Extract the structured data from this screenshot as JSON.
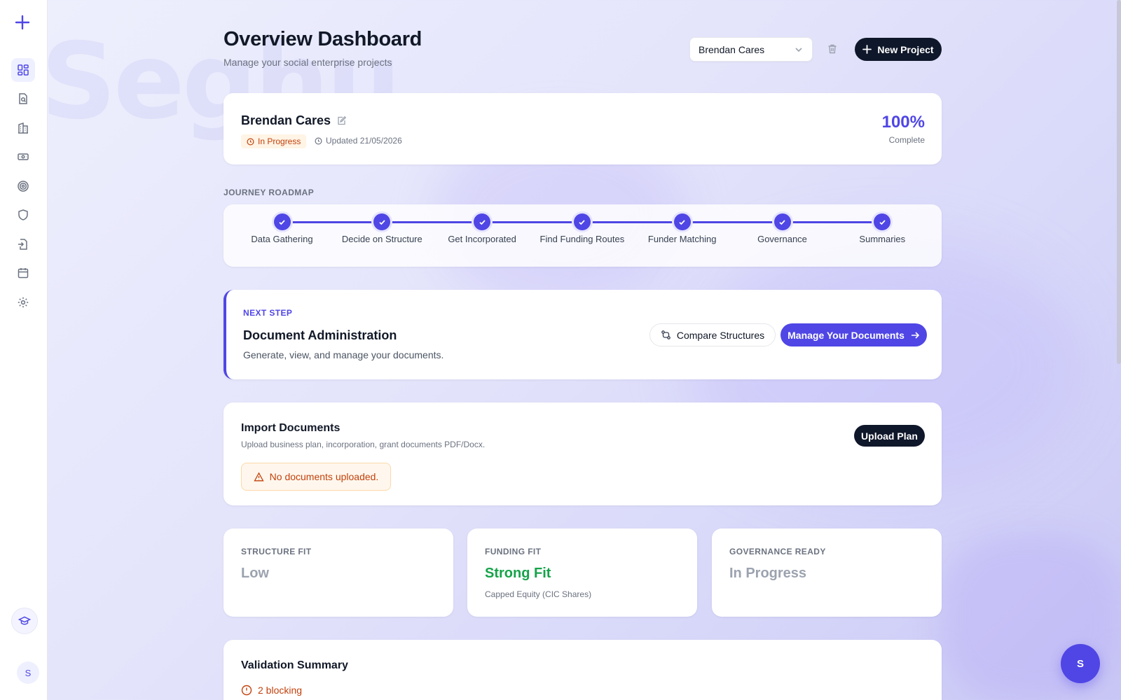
{
  "watermark": "Seghu",
  "header": {
    "title": "Overview Dashboard",
    "subtitle": "Manage your social enterprise projects",
    "project_select_value": "Brendan Cares",
    "new_project_label": "New Project"
  },
  "sidebar": {
    "items": [
      {
        "icon": "dashboard-icon",
        "active": true
      },
      {
        "icon": "document-search-icon",
        "active": false
      },
      {
        "icon": "building-icon",
        "active": false
      },
      {
        "icon": "money-icon",
        "active": false
      },
      {
        "icon": "target-icon",
        "active": false
      },
      {
        "icon": "shield-icon",
        "active": false
      },
      {
        "icon": "file-import-icon",
        "active": false
      },
      {
        "icon": "calendar-icon",
        "active": false
      },
      {
        "icon": "gear-icon",
        "active": false
      }
    ],
    "avatar_initial": "S"
  },
  "project": {
    "name": "Brendan Cares",
    "status": "In Progress",
    "updated": "Updated 21/05/2026",
    "progress_percent": "100%",
    "progress_label": "Complete",
    "progress_value": 100
  },
  "roadmap": {
    "heading": "JOURNEY ROADMAP",
    "steps": [
      {
        "label": "Data Gathering",
        "done": true
      },
      {
        "label": "Decide on Structure",
        "done": true
      },
      {
        "label": "Get Incorporated",
        "done": true
      },
      {
        "label": "Find Funding Routes",
        "done": true
      },
      {
        "label": "Funder Matching",
        "done": true
      },
      {
        "label": "Governance",
        "done": true
      },
      {
        "label": "Summaries",
        "done": true
      }
    ]
  },
  "next_step": {
    "kicker": "NEXT STEP",
    "title": "Document Administration",
    "description": "Generate, view, and manage your documents.",
    "compare_label": "Compare Structures",
    "manage_label": "Manage Your Documents"
  },
  "import": {
    "title": "Import Documents",
    "description": "Upload business plan, incorporation, grant documents PDF/Docx.",
    "upload_label": "Upload Plan",
    "warning": "No documents uploaded."
  },
  "metrics": [
    {
      "label": "STRUCTURE FIT",
      "value": "Low",
      "sub": "",
      "color": "#9ca3af"
    },
    {
      "label": "FUNDING FIT",
      "value": "Strong Fit",
      "sub": "Capped Equity (CIC Shares)",
      "color": "#16a34a"
    },
    {
      "label": "GOVERNANCE READY",
      "value": "In Progress",
      "sub": "",
      "color": "#9ca3af"
    }
  ],
  "validation": {
    "title": "Validation Summary",
    "blocking": "2 blocking"
  },
  "fab_label": "S",
  "colors": {
    "accent": "#4f46e5",
    "dark": "#0f172a",
    "warning": "#c2410c",
    "success": "#16a34a"
  }
}
